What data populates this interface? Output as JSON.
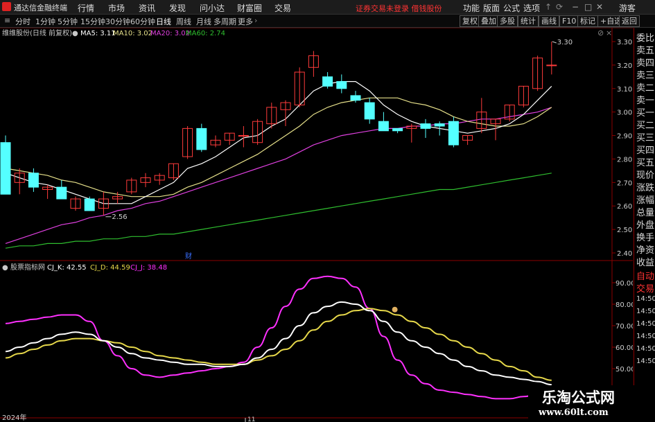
{
  "menubar": {
    "app_title": "通达信金融终端",
    "items": [
      "行情",
      "市场",
      "资讯",
      "发现",
      "问小达",
      "财富圈",
      "交易"
    ],
    "warning": "证券交易未登录 借钱股份",
    "right_items": [
      "功能",
      "版面",
      "公式",
      "选项"
    ],
    "guest": "游客"
  },
  "toolbar": {
    "periods": [
      "分时",
      "1分钟",
      "5分钟",
      "15分钟",
      "30分钟",
      "60分钟",
      "日线",
      "周线",
      "月线",
      "多周期",
      "更多"
    ],
    "active": "日线",
    "right_buttons": [
      "复权",
      "叠加",
      "多股",
      "统计",
      "画线",
      "F10",
      "标记",
      "+自选",
      "返回"
    ]
  },
  "main_legend": {
    "stock": "维维股份(日线 前复权)",
    "ma5": "MA5: 3.11",
    "ma10": "MA10: 3.02",
    "ma20": "MA20: 3.02",
    "ma60": "MA60: 2.74"
  },
  "main_y_labels": [
    "3.30",
    "3.20",
    "3.10",
    "3.00",
    "2.90",
    "2.80",
    "2.70",
    "2.60",
    "2.50",
    "2.40"
  ],
  "annotations": {
    "high": "3.30",
    "low": "2.56",
    "finance_marker": "财"
  },
  "indicator_legend": {
    "name": "股票指标网",
    "k": "CJ_K: 42.55",
    "d": "CJ_D: 44.59",
    "j": "CJ_J: 38.48"
  },
  "indicator_y_labels": [
    "90.00",
    "80.00",
    "70.00",
    "60.00",
    "50.00"
  ],
  "x_labels": [
    "2024年",
    "11"
  ],
  "right_panel": {
    "order_labels": [
      "委比",
      "卖五",
      "卖四",
      "卖三",
      "卖二",
      "卖一",
      "买一",
      "买二",
      "买三",
      "买四",
      "买五",
      "现价",
      "涨跌",
      "涨幅",
      "总量",
      "外盘",
      "换手",
      "净资",
      "收益"
    ],
    "lower_labels": [
      "自动",
      "交易"
    ],
    "times": [
      "14:50",
      "14:50",
      "14:50",
      "14:50",
      "14:50",
      "14:50"
    ]
  },
  "watermark": {
    "title": "乐淘公式网",
    "url": "www.60lt.com"
  },
  "colors": {
    "up": "#ff3b3b",
    "down": "#54ffff",
    "ma5": "#ffffff",
    "ma10": "#e6e08a",
    "ma20": "#e040e0",
    "ma60": "#2fbf2f",
    "cj_k": "#ffffff",
    "cj_d": "#e6d84a",
    "cj_j": "#ff30ff"
  },
  "chart_data": [
    {
      "type": "candlestick",
      "title": "维维股份(日线 前复权)",
      "ylim": [
        2.38,
        3.35
      ],
      "series_note": "open, high, low, close per day",
      "candles": [
        [
          2.87,
          2.9,
          2.65,
          2.65
        ],
        [
          2.7,
          2.76,
          2.65,
          2.74
        ],
        [
          2.74,
          2.76,
          2.66,
          2.68
        ],
        [
          2.67,
          2.69,
          2.63,
          2.68
        ],
        [
          2.68,
          2.71,
          2.63,
          2.63
        ],
        [
          2.59,
          2.64,
          2.58,
          2.63
        ],
        [
          2.63,
          2.64,
          2.58,
          2.58
        ],
        [
          2.59,
          2.66,
          2.56,
          2.63
        ],
        [
          2.63,
          2.66,
          2.61,
          2.64
        ],
        [
          2.66,
          2.72,
          2.65,
          2.71
        ],
        [
          2.7,
          2.74,
          2.68,
          2.72
        ],
        [
          2.71,
          2.74,
          2.69,
          2.73
        ],
        [
          2.72,
          2.78,
          2.71,
          2.78
        ],
        [
          2.81,
          2.94,
          2.8,
          2.93
        ],
        [
          2.93,
          2.95,
          2.83,
          2.84
        ],
        [
          2.86,
          2.9,
          2.85,
          2.88
        ],
        [
          2.88,
          2.91,
          2.86,
          2.91
        ],
        [
          2.9,
          2.94,
          2.85,
          2.9
        ],
        [
          2.87,
          2.97,
          2.86,
          2.96
        ],
        [
          2.95,
          3.04,
          2.93,
          3.02
        ],
        [
          3.01,
          3.05,
          2.94,
          3.04
        ],
        [
          3.03,
          3.19,
          3.02,
          3.17
        ],
        [
          3.19,
          3.26,
          3.15,
          3.24
        ],
        [
          3.15,
          3.17,
          3.1,
          3.11
        ],
        [
          3.13,
          3.16,
          3.08,
          3.1
        ],
        [
          3.07,
          3.09,
          3.04,
          3.05
        ],
        [
          3.04,
          3.06,
          2.95,
          2.97
        ],
        [
          2.96,
          3.0,
          2.92,
          2.92
        ],
        [
          2.93,
          2.93,
          2.91,
          2.92
        ],
        [
          2.93,
          2.95,
          2.87,
          2.94
        ],
        [
          2.95,
          2.97,
          2.89,
          2.93
        ],
        [
          2.95,
          2.96,
          2.9,
          2.94
        ],
        [
          2.96,
          2.98,
          2.85,
          2.86
        ],
        [
          2.88,
          2.9,
          2.86,
          2.9
        ],
        [
          2.93,
          3.06,
          2.91,
          3.0
        ],
        [
          2.95,
          2.97,
          2.88,
          2.97
        ],
        [
          2.97,
          3.03,
          2.96,
          3.03
        ],
        [
          3.03,
          3.11,
          3.02,
          3.11
        ],
        [
          3.1,
          3.24,
          3.09,
          3.23
        ],
        [
          3.2,
          3.3,
          3.16,
          3.2
        ]
      ],
      "ma5": [
        2.74,
        2.72,
        2.7,
        2.69,
        2.67,
        2.65,
        2.63,
        2.61,
        2.61,
        2.61,
        2.64,
        2.67,
        2.7,
        2.76,
        2.78,
        2.81,
        2.85,
        2.89,
        2.9,
        2.94,
        2.97,
        3.03,
        3.09,
        3.12,
        3.13,
        3.13,
        3.09,
        3.03,
        2.99,
        2.96,
        2.94,
        2.93,
        2.92,
        2.91,
        2.92,
        2.93,
        2.95,
        2.99,
        3.05,
        3.11
      ],
      "ma10": [
        2.76,
        2.75,
        2.74,
        2.73,
        2.71,
        2.7,
        2.68,
        2.66,
        2.65,
        2.64,
        2.64,
        2.64,
        2.65,
        2.68,
        2.7,
        2.73,
        2.76,
        2.79,
        2.82,
        2.86,
        2.9,
        2.94,
        2.99,
        3.02,
        3.04,
        3.05,
        3.06,
        3.06,
        3.06,
        3.04,
        3.03,
        3.01,
        2.98,
        2.96,
        2.95,
        2.94,
        2.94,
        2.95,
        2.98,
        3.02
      ],
      "ma20": [
        2.44,
        2.46,
        2.48,
        2.5,
        2.52,
        2.53,
        2.55,
        2.56,
        2.58,
        2.59,
        2.61,
        2.62,
        2.64,
        2.66,
        2.68,
        2.7,
        2.72,
        2.74,
        2.76,
        2.78,
        2.8,
        2.83,
        2.86,
        2.88,
        2.9,
        2.91,
        2.92,
        2.93,
        2.93,
        2.94,
        2.94,
        2.95,
        2.95,
        2.96,
        2.97,
        2.97,
        2.98,
        2.99,
        3.0,
        3.02
      ],
      "ma60": [
        2.42,
        2.43,
        2.43,
        2.44,
        2.44,
        2.45,
        2.45,
        2.46,
        2.46,
        2.47,
        2.47,
        2.48,
        2.48,
        2.49,
        2.5,
        2.51,
        2.52,
        2.53,
        2.54,
        2.55,
        2.56,
        2.57,
        2.58,
        2.59,
        2.6,
        2.61,
        2.62,
        2.63,
        2.64,
        2.65,
        2.66,
        2.67,
        2.67,
        2.68,
        2.69,
        2.7,
        2.71,
        2.72,
        2.73,
        2.74
      ]
    },
    {
      "type": "line",
      "title": "股票指标网",
      "ylim": [
        40,
        97
      ],
      "series": [
        {
          "name": "CJ_K",
          "values": [
            58,
            60,
            62,
            64,
            66,
            67,
            66,
            63,
            60,
            57,
            55,
            54,
            53,
            52,
            52,
            51,
            51,
            52,
            55,
            59,
            64,
            70,
            76,
            79,
            81,
            80,
            77,
            72,
            67,
            63,
            60,
            57,
            54,
            51,
            49,
            47,
            46,
            45,
            44,
            42.55
          ]
        },
        {
          "name": "CJ_D",
          "values": [
            55,
            57,
            59,
            61,
            63,
            64,
            64,
            63,
            62,
            60,
            58,
            56,
            55,
            54,
            53,
            52,
            52,
            52,
            54,
            56,
            59,
            63,
            68,
            72,
            75,
            77,
            78,
            77,
            75,
            72,
            69,
            66,
            63,
            60,
            57,
            54,
            51,
            49,
            46,
            44.59
          ]
        },
        {
          "name": "CJ_J",
          "values": [
            71,
            72,
            73,
            74,
            75,
            75,
            72,
            63,
            56,
            50,
            47,
            46,
            47,
            48,
            49,
            50,
            51,
            53,
            60,
            69,
            79,
            87,
            92,
            93,
            92,
            88,
            78,
            65,
            54,
            47,
            43,
            40,
            39,
            38,
            37,
            36,
            36,
            37,
            38,
            38.48
          ]
        }
      ]
    }
  ]
}
